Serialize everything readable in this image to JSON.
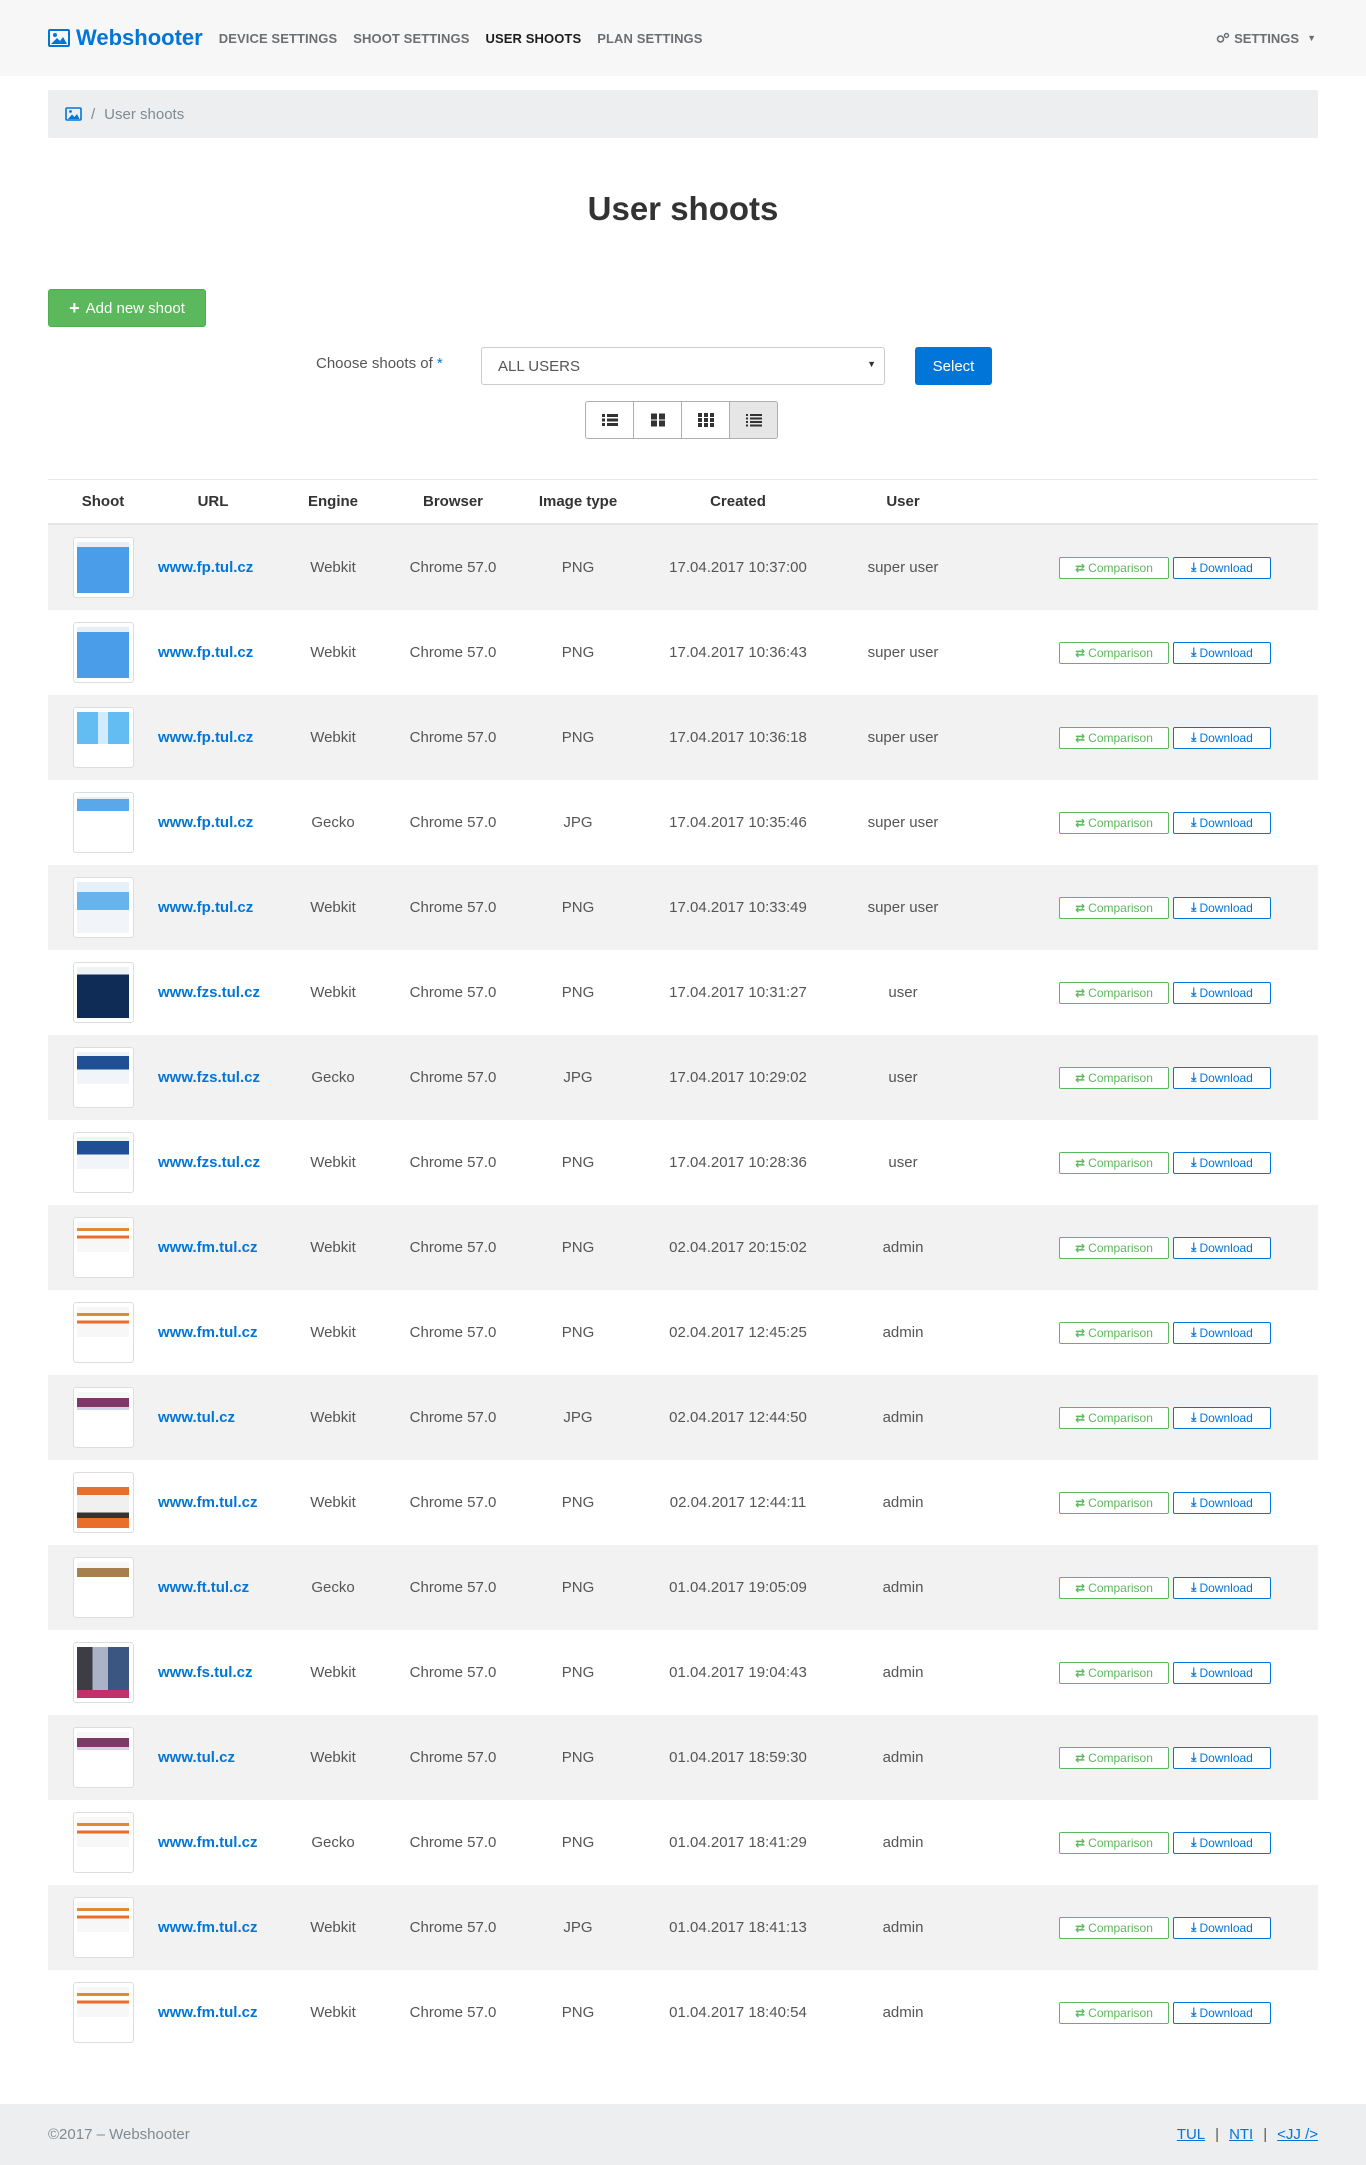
{
  "navbar": {
    "brand": "Webshooter",
    "links": [
      {
        "label": "DEVICE SETTINGS",
        "active": false
      },
      {
        "label": "SHOOT SETTINGS",
        "active": false
      },
      {
        "label": "USER SHOOTS",
        "active": true
      },
      {
        "label": "PLAN SETTINGS",
        "active": false
      }
    ],
    "settings_label": "SETTINGS"
  },
  "breadcrumb": {
    "current": "User shoots"
  },
  "page_title": "User shoots",
  "add_button_label": "Add new shoot",
  "filter": {
    "label": "Choose shoots of",
    "required_mark": "*",
    "selected_value": "ALL USERS",
    "select_button": "Select"
  },
  "view_modes": [
    "list-icon",
    "grid-large-icon",
    "grid-small-icon",
    "table-list-icon"
  ],
  "table": {
    "headers": {
      "shoot": "Shoot",
      "url": "URL",
      "engine": "Engine",
      "browser": "Browser",
      "image_type": "Image type",
      "created": "Created",
      "user": "User"
    },
    "comparison_label": "Comparison",
    "download_label": "Download",
    "rows": [
      {
        "thumb": "blue",
        "url": "www.fp.tul.cz",
        "engine": "Webkit",
        "browser": "Chrome 57.0",
        "type": "PNG",
        "created": "17.04.2017 10:37:00",
        "user": "super user"
      },
      {
        "thumb": "blue",
        "url": "www.fp.tul.cz",
        "engine": "Webkit",
        "browser": "Chrome 57.0",
        "type": "PNG",
        "created": "17.04.2017 10:36:43",
        "user": "super user"
      },
      {
        "thumb": "mixed",
        "url": "www.fp.tul.cz",
        "engine": "Webkit",
        "browser": "Chrome 57.0",
        "type": "PNG",
        "created": "17.04.2017 10:36:18",
        "user": "super user"
      },
      {
        "thumb": "bar",
        "url": "www.fp.tul.cz",
        "engine": "Gecko",
        "browser": "Chrome 57.0",
        "type": "JPG",
        "created": "17.04.2017 10:35:46",
        "user": "super user"
      },
      {
        "thumb": "mid",
        "url": "www.fp.tul.cz",
        "engine": "Webkit",
        "browser": "Chrome 57.0",
        "type": "PNG",
        "created": "17.04.2017 10:33:49",
        "user": "super user"
      },
      {
        "thumb": "dark",
        "url": "www.fzs.tul.cz",
        "engine": "Webkit",
        "browser": "Chrome 57.0",
        "type": "PNG",
        "created": "17.04.2017 10:31:27",
        "user": "user"
      },
      {
        "thumb": "darksm",
        "url": "www.fzs.tul.cz",
        "engine": "Gecko",
        "browser": "Chrome 57.0",
        "type": "JPG",
        "created": "17.04.2017 10:29:02",
        "user": "user"
      },
      {
        "thumb": "darksm",
        "url": "www.fzs.tul.cz",
        "engine": "Webkit",
        "browser": "Chrome 57.0",
        "type": "PNG",
        "created": "17.04.2017 10:28:36",
        "user": "user"
      },
      {
        "thumb": "orange",
        "url": "www.fm.tul.cz",
        "engine": "Webkit",
        "browser": "Chrome 57.0",
        "type": "PNG",
        "created": "02.04.2017 20:15:02",
        "user": "admin"
      },
      {
        "thumb": "orange",
        "url": "www.fm.tul.cz",
        "engine": "Webkit",
        "browser": "Chrome 57.0",
        "type": "PNG",
        "created": "02.04.2017 12:45:25",
        "user": "admin"
      },
      {
        "thumb": "purple",
        "url": "www.tul.cz",
        "engine": "Webkit",
        "browser": "Chrome 57.0",
        "type": "JPG",
        "created": "02.04.2017 12:44:50",
        "user": "admin"
      },
      {
        "thumb": "long",
        "url": "www.fm.tul.cz",
        "engine": "Webkit",
        "browser": "Chrome 57.0",
        "type": "PNG",
        "created": "02.04.2017 12:44:11",
        "user": "admin"
      },
      {
        "thumb": "brown",
        "url": "www.ft.tul.cz",
        "engine": "Gecko",
        "browser": "Chrome 57.0",
        "type": "PNG",
        "created": "01.04.2017 19:05:09",
        "user": "admin"
      },
      {
        "thumb": "collage",
        "url": "www.fs.tul.cz",
        "engine": "Webkit",
        "browser": "Chrome 57.0",
        "type": "PNG",
        "created": "01.04.2017 19:04:43",
        "user": "admin"
      },
      {
        "thumb": "purple",
        "url": "www.tul.cz",
        "engine": "Webkit",
        "browser": "Chrome 57.0",
        "type": "PNG",
        "created": "01.04.2017 18:59:30",
        "user": "admin"
      },
      {
        "thumb": "orange",
        "url": "www.fm.tul.cz",
        "engine": "Gecko",
        "browser": "Chrome 57.0",
        "type": "PNG",
        "created": "01.04.2017 18:41:29",
        "user": "admin"
      },
      {
        "thumb": "orange",
        "url": "www.fm.tul.cz",
        "engine": "Webkit",
        "browser": "Chrome 57.0",
        "type": "JPG",
        "created": "01.04.2017 18:41:13",
        "user": "admin"
      },
      {
        "thumb": "orange",
        "url": "www.fm.tul.cz",
        "engine": "Webkit",
        "browser": "Chrome 57.0",
        "type": "PNG",
        "created": "01.04.2017 18:40:54",
        "user": "admin"
      }
    ]
  },
  "footer": {
    "copyright": "©2017 – Webshooter",
    "links": [
      "TUL",
      "NTI",
      "<JJ />"
    ]
  },
  "colors": {
    "primary": "#0275d8",
    "success": "#5cb85c"
  }
}
